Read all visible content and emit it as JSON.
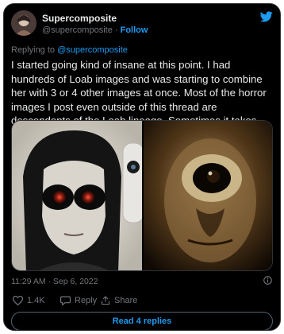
{
  "author": {
    "display_name": "Supercomposite",
    "handle": "@supercomposite",
    "separator": " · ",
    "follow_label": "Follow"
  },
  "reply_context": {
    "prefix": "Replying to ",
    "mention": "@supercomposite"
  },
  "tweet": {
    "text": "I started going kind of insane at this point. I had hundreds of Loab images and was starting to combine her with 3 or 4 other images at once. Most of the horror images I post even outside of this thread are descendents of the Loab lineage. Sometimes it takes more abstract forms.",
    "timestamp": "11:29 AM · Sep 6, 2022"
  },
  "actions": {
    "likes": "1.4K",
    "reply_label": "Reply",
    "share_label": "Share"
  },
  "read_replies_label": "Read 4 replies",
  "icons": {
    "brand": "twitter-bird-icon",
    "like": "heart-icon",
    "reply": "speech-bubble-icon",
    "share": "share-arrow-icon",
    "info": "info-icon"
  },
  "colors": {
    "background": "#000000",
    "text": "#e7e9ea",
    "secondary": "#71767b",
    "accent": "#1d9bf0",
    "border": "#2f3336"
  }
}
